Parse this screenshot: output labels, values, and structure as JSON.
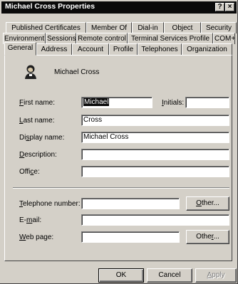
{
  "window": {
    "title": "Michael Cross Properties",
    "help_button": "?",
    "close_button": "×"
  },
  "tabs": {
    "row1": [
      "Published Certificates",
      "Member Of",
      "Dial-in",
      "Object",
      "Security"
    ],
    "row2": [
      "Environment",
      "Sessions",
      "Remote control",
      "Terminal Services Profile",
      "COM+"
    ],
    "row3": [
      "General",
      "Address",
      "Account",
      "Profile",
      "Telephones",
      "Organization"
    ],
    "active": "General"
  },
  "general": {
    "display_heading": "Michael Cross",
    "user_icon": "user-icon",
    "fields": {
      "first_name": {
        "label": "First name:",
        "value": "Michael"
      },
      "initials": {
        "label": "Initials:",
        "value": ""
      },
      "last_name": {
        "label": "Last name:",
        "value": "Cross"
      },
      "display_name": {
        "label": "Display name:",
        "value": "Michael Cross"
      },
      "description": {
        "label": "Description:",
        "value": ""
      },
      "office": {
        "label": "Office:",
        "value": ""
      },
      "telephone": {
        "label": "Telephone number:",
        "value": ""
      },
      "email": {
        "label": "E-mail:",
        "value": ""
      },
      "web_page": {
        "label": "Web page:",
        "value": ""
      }
    },
    "other_button": "Other..."
  },
  "footer": {
    "ok": "OK",
    "cancel": "Cancel",
    "apply": "Apply"
  },
  "colors": {
    "face": "#d4d0c8",
    "title_bar": "#0a0a0a",
    "shadow": "#808080",
    "dark_shadow": "#404040"
  }
}
